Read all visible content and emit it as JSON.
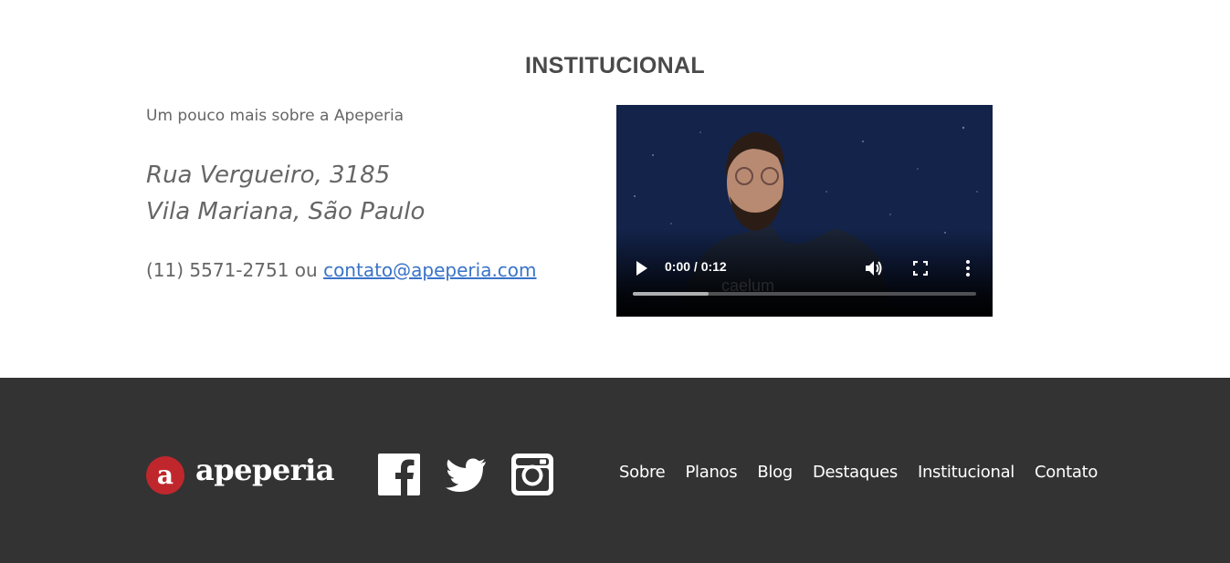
{
  "institucional": {
    "title": "INSTITUCIONAL",
    "subtitle": "Um pouco mais sobre a Apeperia",
    "address_line1": "Rua Vergueiro, 3185",
    "address_line2": "Vila Mariana, São Paulo",
    "phone": "(11) 5571-2751",
    "connector": " ou ",
    "email": "contato@apeperia.com"
  },
  "video": {
    "time_display": "0:00 / 0:12",
    "progress_fraction": 0.0,
    "buffered_fraction": 0.22,
    "watermark": "caelum",
    "controls": {
      "play_icon": "play-icon",
      "volume_icon": "volume-icon",
      "fullscreen_icon": "fullscreen-icon",
      "more_icon": "more-vertical-icon"
    }
  },
  "footer": {
    "logo_letter": "a",
    "logo_text": "apeperia",
    "social_icons": [
      "facebook-icon",
      "twitter-icon",
      "instagram-icon"
    ],
    "nav": [
      "Sobre",
      "Planos",
      "Blog",
      "Destaques",
      "Institucional",
      "Contato"
    ],
    "colors": {
      "background": "#333333",
      "logo_red": "#c0272d",
      "link_blue": "#3a73c8"
    }
  }
}
